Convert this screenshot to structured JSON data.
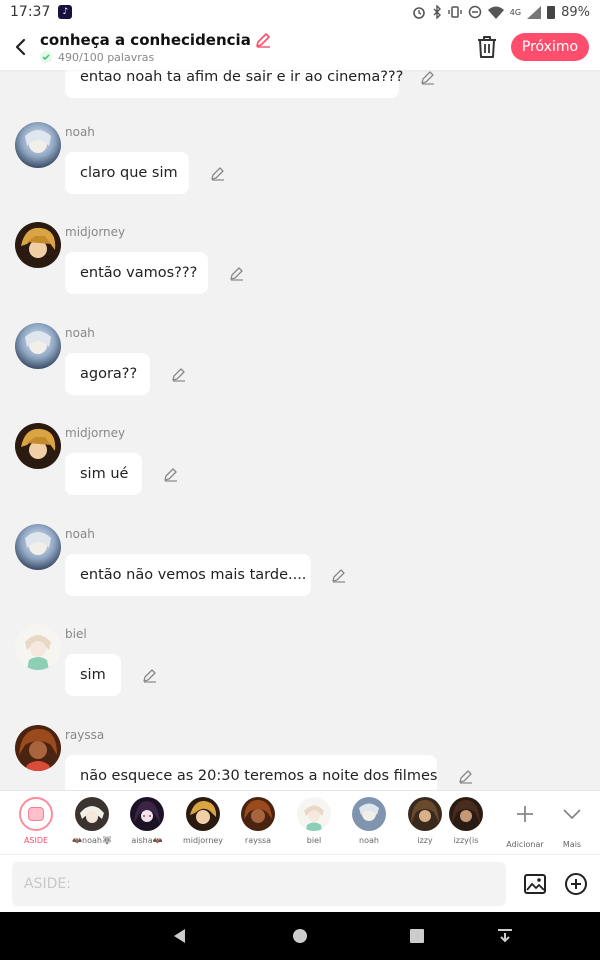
{
  "status_bar": {
    "time": "17:37",
    "app_badge": "♪",
    "network": "4G",
    "battery": "89%"
  },
  "header": {
    "title": "conheça a conhecidencia",
    "word_count": "490/100 palavras",
    "next_label": "Próximo",
    "accent_color": "#ff4d6d"
  },
  "messages": [
    {
      "author": "",
      "text": "entao noah ta afim de sair e ir ao cinema???",
      "avatar": ""
    },
    {
      "author": "noah",
      "text": "claro que sim",
      "avatar": "noah"
    },
    {
      "author": "midjorney",
      "text": "então vamos???",
      "avatar": "midjorney"
    },
    {
      "author": "noah",
      "text": "agora??",
      "avatar": "noah"
    },
    {
      "author": "midjorney",
      "text": "sim ué",
      "avatar": "midjorney"
    },
    {
      "author": "noah",
      "text": "então não vemos mais tarde....",
      "avatar": "noah"
    },
    {
      "author": "biel",
      "text": "sim",
      "avatar": "biel"
    },
    {
      "author": "rayssa",
      "text": "não esquece as 20:30 teremos a noite dos filmes",
      "avatar": "rayssa"
    }
  ],
  "characters": [
    {
      "label": "ASIDE",
      "icon": "aside-icon"
    },
    {
      "label": "🦇noah🐺",
      "icon": "noah"
    },
    {
      "label": "aisha🦇",
      "icon": "aisha"
    },
    {
      "label": "midjorney",
      "icon": "midjorney"
    },
    {
      "label": "rayssa",
      "icon": "rayssa"
    },
    {
      "label": "biel",
      "icon": "biel"
    },
    {
      "label": "noah",
      "icon": "noah"
    },
    {
      "label": "izzy",
      "icon": "izzy"
    },
    {
      "label": "izzy(is",
      "icon": "izzy2"
    },
    {
      "label": "Adicionar",
      "icon": "plus-icon"
    },
    {
      "label": "Mais",
      "icon": "chevron-down-icon"
    }
  ],
  "input": {
    "placeholder": "ASIDE:"
  }
}
